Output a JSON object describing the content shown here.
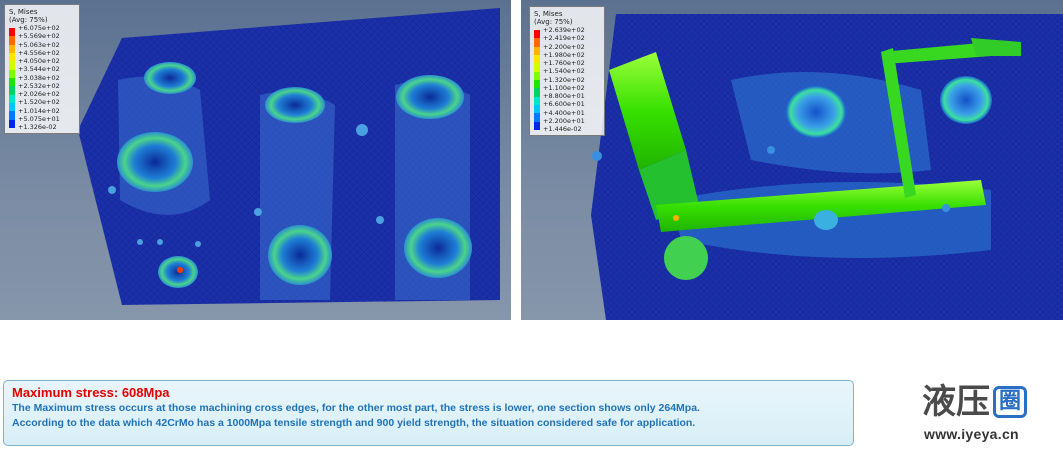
{
  "left_panel": {
    "legend": {
      "title": "S, Mises",
      "avg": "(Avg: 75%)",
      "values": [
        "+6.075e+02",
        "+5.569e+02",
        "+5.063e+02",
        "+4.556e+02",
        "+4.050e+02",
        "+3.544e+02",
        "+3.038e+02",
        "+2.532e+02",
        "+2.026e+02",
        "+1.520e+02",
        "+1.014e+02",
        "+5.075e+01",
        "+1.326e-02"
      ]
    }
  },
  "right_panel": {
    "legend": {
      "title": "S, Mises",
      "avg": "(Avg: 75%)",
      "values": [
        "+2.639e+02",
        "+2.419e+02",
        "+2.200e+02",
        "+1.980e+02",
        "+1.760e+02",
        "+1.540e+02",
        "+1.320e+02",
        "+1.100e+02",
        "+8.800e+01",
        "+6.600e+01",
        "+4.400e+01",
        "+2.200e+01",
        "+1.446e-02"
      ]
    }
  },
  "legend_colors": [
    "#ff0000",
    "#ff6a00",
    "#ffb400",
    "#ffe600",
    "#d2ff00",
    "#7dff00",
    "#1fe600",
    "#00d264",
    "#00e6c8",
    "#00c8ff",
    "#0078ff",
    "#0028e6",
    "#0000b4"
  ],
  "info": {
    "title": "Maximum stress: 608Mpa",
    "line1": "The Maximum stress occurs at those machining cross edges, for the other most part, the stress is lower, one section shows only 264Mpa.",
    "line2": "According to the data which 42CrMo has a 1000Mpa tensile strength and 900 yield strength,  the situation considered safe for application."
  },
  "brand": {
    "name_part1": "液",
    "name_part2": "压",
    "name_mark": "圈",
    "url": "www.iyeya.cn"
  },
  "colors": {
    "accent_red": "#e60000",
    "text_blue": "#1f72b8",
    "mesh_blue": "#1a2fa8",
    "brand_blue": "#2a6fc4"
  }
}
